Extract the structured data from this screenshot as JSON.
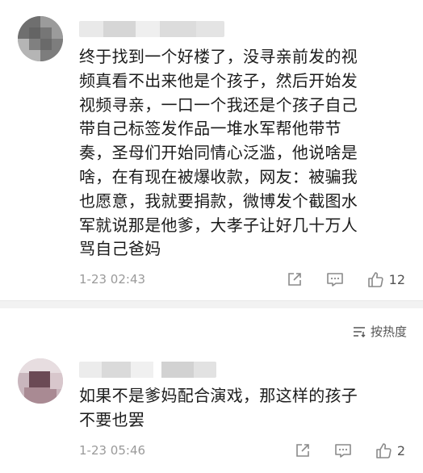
{
  "comments": [
    {
      "text": "终于找到一个好楼了，没寻亲前发的视\n频真看不出来他是个孩子，然后开始发\n视频寻亲，一口一个我还是个孩子自己\n带自己标签发作品一堆水军帮他带节\n奏，圣母们开始同情心泛滥，他说啥是\n啥，在有现在被爆收款，网友：被骗我\n也愿意，我就要捐款，微博发个截图水\n军就说那是他爹，大孝子让好几十万人\n骂自己爸妈",
      "time": "1-23 02:43",
      "likes": "12"
    },
    {
      "text": "如果不是爹妈配合演戏，那这样的孩子\n不要也罢",
      "time": "1-23 05:46",
      "likes": "2"
    }
  ],
  "sort": {
    "label": "按热度"
  },
  "icons": {
    "share": "share-icon",
    "comment": "comment-icon",
    "like": "thumbs-up-icon",
    "sort": "sort-icon"
  },
  "colors": {
    "text": "#1b1b1b",
    "meta": "#9a9a9a",
    "divider": "#f2f2f2"
  }
}
